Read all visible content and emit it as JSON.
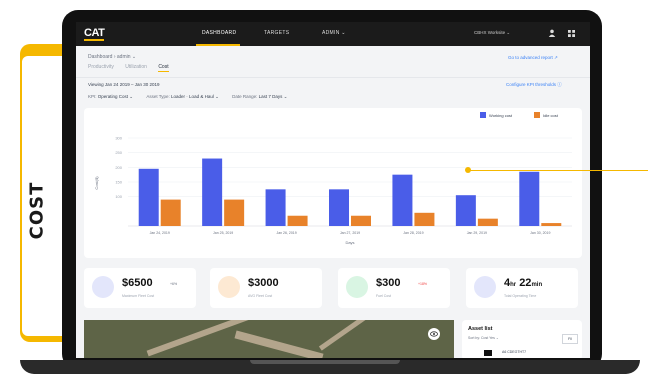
{
  "side_tab": {
    "label": "COST"
  },
  "topbar": {
    "logo": "CAT",
    "nav": [
      "DASHBOARD",
      "TARGETS",
      "ADMIN ⌄"
    ],
    "org": "CBHX Worksite ⌄"
  },
  "breadcrumb": "Dashboard › admin ⌄",
  "subtabs": [
    "Productivity",
    "Utilization",
    "Cost"
  ],
  "links": {
    "top_right": "Go to advanced report ↗",
    "configure": "Configure KPI thresholds ⓘ"
  },
  "date_range": "Viewing Jan 24 2019 – Jan 30 2019",
  "filters": [
    {
      "label": "KPI:",
      "value": "Operating Cost ⌄"
    },
    {
      "label": "Asset Type:",
      "value": "Loader · Load & Haul ⌄"
    },
    {
      "label": "Date Range:",
      "value": "Last 7 Days ⌄"
    }
  ],
  "colors": {
    "accent": "#f5b800",
    "series1": "#4a5de8",
    "series2": "#e8822a"
  },
  "chart_data": {
    "type": "bar",
    "categories": [
      "Jan 24, 2019",
      "Jan 25, 2019",
      "Jan 26, 2019",
      "Jan 27, 2019",
      "Jan 28, 2019",
      "Jan 29, 2019",
      "Jan 30, 2019"
    ],
    "series": [
      {
        "name": "Working cost",
        "values": [
          195,
          230,
          125,
          125,
          175,
          105,
          185
        ]
      },
      {
        "name": "Idle cost",
        "values": [
          90,
          90,
          35,
          35,
          45,
          25,
          10
        ]
      }
    ],
    "ylabel": "Cost($)",
    "xlabel": "Days",
    "ylim": [
      0,
      300
    ],
    "yticks": [
      "300",
      "250",
      "200",
      "150",
      "100"
    ],
    "legend_position": "top-right",
    "grid": true
  },
  "stats": [
    {
      "value": "$6500",
      "unit": "",
      "badge": "+6%",
      "label": "Maximum Fleet Cost",
      "icon": "dollar-icon",
      "color": "#e3e6fb"
    },
    {
      "value": "$3000",
      "unit": "",
      "badge": "",
      "label": "AVG Fleet Cost",
      "icon": "fuel-icon",
      "color": "#fde9d3"
    },
    {
      "value": "$300",
      "unit": "",
      "badge": "+18%",
      "label": "Fuel Cost",
      "icon": "refresh-icon",
      "color": "#d9f5e3"
    },
    {
      "value": "4",
      "unit": "hr",
      "value2": "22",
      "unit2": "min",
      "label": "Total Operating Time",
      "icon": "clock-icon",
      "color": "#e3e6fb"
    }
  ],
  "asset_list": {
    "title": "Asset list",
    "filter": "Sort by: Cost  Yes ⌄",
    "select": "Fil",
    "item": "A6 CDEGTHT7"
  }
}
